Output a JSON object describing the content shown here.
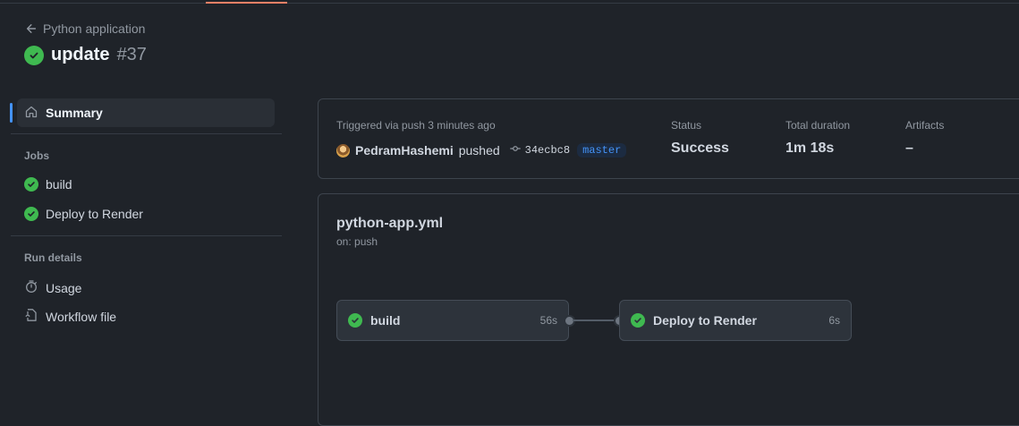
{
  "header": {
    "back_label": "Python application",
    "title": "update",
    "run_number": "#37"
  },
  "sidebar": {
    "summary_label": "Summary",
    "jobs_heading": "Jobs",
    "jobs": [
      {
        "label": "build"
      },
      {
        "label": "Deploy to Render"
      }
    ],
    "run_details_heading": "Run details",
    "details": [
      {
        "label": "Usage"
      },
      {
        "label": "Workflow file"
      }
    ]
  },
  "summary": {
    "trigger_text": "Triggered via push 3 minutes ago",
    "user": "PedramHashemi",
    "action": "pushed",
    "commit": "34ecbc8",
    "branch": "master",
    "status_label": "Status",
    "status_value": "Success",
    "duration_label": "Total duration",
    "duration_value": "1m 18s",
    "artifacts_label": "Artifacts",
    "artifacts_value": "–"
  },
  "workflow": {
    "file": "python-app.yml",
    "trigger": "on: push",
    "jobs": [
      {
        "name": "build",
        "duration": "56s"
      },
      {
        "name": "Deploy to Render",
        "duration": "6s"
      }
    ]
  },
  "colors": {
    "success": "#3fb950",
    "accent": "#4493f8",
    "tab_underline": "#f78166",
    "background": "#1f2329"
  }
}
